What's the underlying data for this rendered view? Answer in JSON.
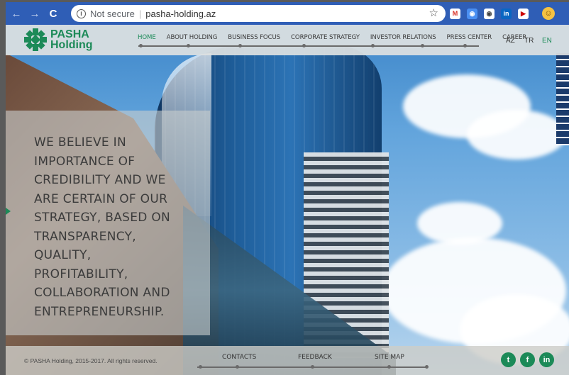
{
  "browser": {
    "url": "pasha-holding.az",
    "security_label": "Not secure",
    "back_icon": "arrow-left-icon",
    "forward_icon": "arrow-right-icon",
    "reload_icon": "reload-icon"
  },
  "brand": {
    "name_line1": "PASHA",
    "name_line2": "Holding",
    "accent_color": "#1c8a58"
  },
  "nav": {
    "items": [
      {
        "label": "HOME",
        "active": true
      },
      {
        "label": "ABOUT HOLDING",
        "active": false
      },
      {
        "label": "BUSINESS FOCUS",
        "active": false
      },
      {
        "label": "CORPORATE STRATEGY",
        "active": false
      },
      {
        "label": "INVESTOR RELATIONS",
        "active": false
      },
      {
        "label": "PRESS CENTER",
        "active": false
      },
      {
        "label": "CAREER",
        "active": false
      }
    ],
    "languages": [
      {
        "label": "AZ",
        "active": false
      },
      {
        "label": "TR",
        "active": false
      },
      {
        "label": "EN",
        "active": true
      }
    ]
  },
  "hero": {
    "quote": "WE BELIEVE IN\nIMPORTANCE OF\nCREDIBILITY AND WE\nARE CERTAIN OF OUR\nSTRATEGY, BASED ON\nTRANSPARENCY,\nQUALITY,\nPROFITABILITY,\nCOLLABORATION AND\nENTREPRENEURSHIP."
  },
  "footer": {
    "copyright": "© PASHA Holding, 2015-2017. All rights reserved.",
    "links": [
      "CONTACTS",
      "FEEDBACK",
      "SITE MAP"
    ],
    "social": [
      "twitter-icon",
      "facebook-icon",
      "linkedin-icon"
    ]
  }
}
